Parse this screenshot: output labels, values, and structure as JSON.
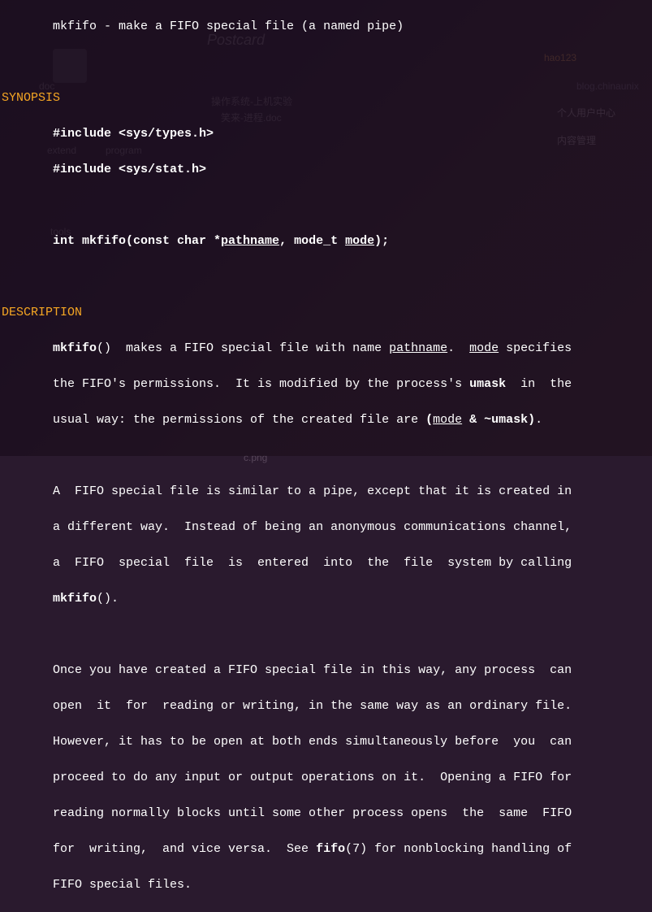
{
  "name_line": "       mkfifo - make a FIFO special file (a named pipe)",
  "synopsis": {
    "heading": "SYNOPSIS",
    "inc1": "       #include <sys/types.h>",
    "inc2": "       #include <sys/stat.h>",
    "sig_pre": "       int mkfifo(const char *",
    "sig_path": "pathname",
    "sig_mid": ", mode_t ",
    "sig_mode": "mode",
    "sig_end": ");"
  },
  "description": {
    "heading": "DESCRIPTION",
    "p1_pre": "       ",
    "p1_mkfifo": "mkfifo",
    "p1_t1": "()  makes a FIFO special file with name ",
    "p1_path": "pathname",
    "p1_t2": ".  ",
    "p1_mode": "mode",
    "p1_t3": " specifies",
    "p1_l2a": "       the FIFO's permissions.  It is modified by the process's ",
    "p1_umask": "umask",
    "p1_l2b": "  in  the",
    "p1_l3a": "       usual way: the permissions of the created file are ",
    "p1_paren_open": "(",
    "p1_mode2": "mode",
    "p1_amp": " & ~umask)",
    "p1_l3b": ".",
    "p2_l1": "       A  FIFO special file is similar to a pipe, except that it is created in",
    "p2_l2": "       a different way.  Instead of being an anonymous communications channel,",
    "p2_l3": "       a  FIFO  special  file  is  entered  into  the  file  system by calling",
    "p2_l4_pre": "       ",
    "p2_mkfifo": "mkfifo",
    "p2_l4_post": "().",
    "p3_l1": "       Once you have created a FIFO special file in this way, any process  can",
    "p3_l2": "       open  it  for  reading or writing, in the same way as an ordinary file.",
    "p3_l3": "       However, it has to be open at both ends simultaneously before  you  can",
    "p3_l4": "       proceed to do any input or output operations on it.  Opening a FIFO for",
    "p3_l5": "       reading normally blocks until some other process opens  the  same  FIFO",
    "p3_l6a": "       for  writing,  and vice versa.  See ",
    "p3_fifo": "fifo",
    "p3_l6b": "(7) for nonblocking handling of",
    "p3_l7": "       FIFO special files."
  },
  "ghosts": {
    "doc": "doc",
    "extend": "extend",
    "program": "program",
    "tools": "tools",
    "os": "操作系统-上机实验",
    "doc2": "笑来-进程.doc",
    "hao": "hao123",
    "center": "个人用户中心",
    "nav": "内容管理",
    "blog": "blog.chinaunix",
    "pic": "c.png",
    "postcard": "Postcard"
  }
}
